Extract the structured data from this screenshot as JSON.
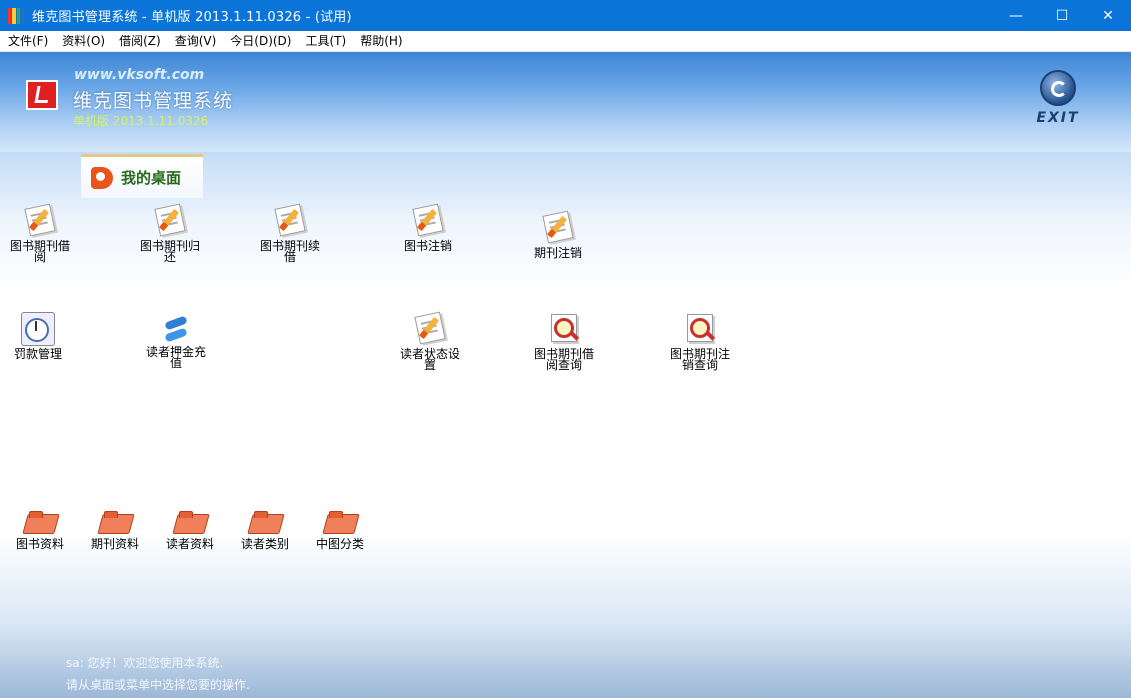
{
  "window": {
    "title": "维克图书管理系统 - 单机版 2013.1.11.0326 - (试用)",
    "minimize_glyph": "—",
    "maximize_glyph": "☐",
    "close_glyph": "✕"
  },
  "menu": [
    {
      "label": "文件(F)"
    },
    {
      "label": "资料(O)"
    },
    {
      "label": "借阅(Z)"
    },
    {
      "label": "查询(V)"
    },
    {
      "label": "今日(D)(D)"
    },
    {
      "label": "工具(T)"
    },
    {
      "label": "帮助(H)"
    }
  ],
  "banner": {
    "site_url": "www.vksoft.com",
    "app_name": "维克图书管理系统",
    "edition": "单机版 2013.1.11.0326",
    "exit_label": "EXIT"
  },
  "tab": {
    "label": "我的桌面"
  },
  "shortcuts": [
    {
      "label": "图书期刊借阅",
      "icon": "edit-document-icon"
    },
    {
      "label": "图书期刊归还",
      "icon": "edit-document-icon"
    },
    {
      "label": "图书期刊续借",
      "icon": "edit-document-icon"
    },
    {
      "label": "图书注销",
      "icon": "edit-document-icon"
    },
    {
      "label": "期刊注销",
      "icon": "edit-document-icon"
    },
    {
      "label": "罚款管理",
      "icon": "clock-icon"
    },
    {
      "label": "读者押金充值",
      "icon": "refresh-icon"
    },
    {
      "label": "读者状态设置",
      "icon": "edit-document-icon"
    },
    {
      "label": "图书期刊借阅查询",
      "icon": "search-document-icon"
    },
    {
      "label": "图书期刊注销查询",
      "icon": "search-document-icon"
    },
    {
      "label": "图书资料",
      "icon": "folder-icon"
    },
    {
      "label": "期刊资料",
      "icon": "folder-icon"
    },
    {
      "label": "读者资料",
      "icon": "folder-icon"
    },
    {
      "label": "读者类别",
      "icon": "folder-icon"
    },
    {
      "label": "中图分类",
      "icon": "folder-icon"
    }
  ],
  "status": {
    "greeting": "sa: 您好！欢迎您使用本系统.",
    "hint": "请从桌面或菜单中选择您要的操作."
  }
}
